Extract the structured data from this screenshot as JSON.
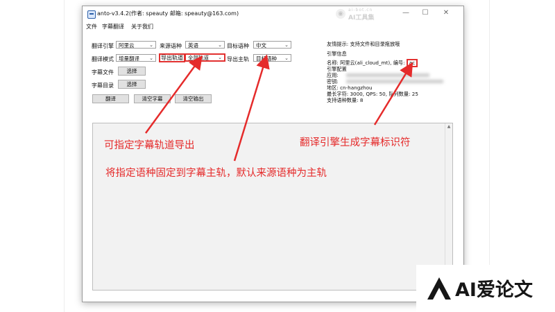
{
  "window": {
    "title": "anto-v3.4.2(作者: speauty 邮箱: speauty@163.com)",
    "watermark_small": "ai-bot.cn",
    "watermark_big": "AI工具集",
    "minimize": "—",
    "maximize": "☐",
    "close": "✕"
  },
  "menu": [
    "文件",
    "字幕翻译",
    "关于我们"
  ],
  "form": {
    "engine_label": "翻译引擎",
    "engine_value": "阿里云",
    "source_lang_label": "来源语种",
    "source_lang_value": "英语",
    "target_lang_label": "目标语种",
    "target_lang_value": "中文",
    "mode_label": "翻译模式",
    "mode_value": "增量翻译",
    "export_track_label": "导出轨道",
    "export_track_value": "全部轨道",
    "main_track_label": "导出主轨",
    "main_track_value": "目标语种",
    "subtitle_file_label": "字幕文件",
    "subtitle_file_button": "选择",
    "subtitle_dir_label": "字幕目录",
    "subtitle_dir_button": "选择",
    "translate_button": "翻译",
    "clear_subtitle_button": "清空字幕",
    "clear_output_button": "清空输出"
  },
  "info": {
    "tip": "友情提示: 支持文件和目录拖放哦",
    "engine_info": "引擎信息",
    "name_prefix": "名称: 阿里云(ali_cloud_mt), 编号:",
    "code": "ac",
    "engine_config": "引擎配置",
    "app": "应用:",
    "key": "密钥:",
    "region": "地区: cn-hangzhou",
    "limits": "最长字符: 3000, QPS: 50, 队列数量: 25",
    "lang_count": "支持语种数量: 8"
  },
  "annotations": {
    "track_export": "可指定字幕轨道导出",
    "engine_id": "翻译引擎生成字幕标识符",
    "main_track": "将指定语种固定到字幕主轨，默认来源语种为主轨"
  },
  "brand": {
    "text": "AI爱论文"
  },
  "colors": {
    "annotation_red": "#e52b2b",
    "highlight_border": "#e2302f"
  }
}
